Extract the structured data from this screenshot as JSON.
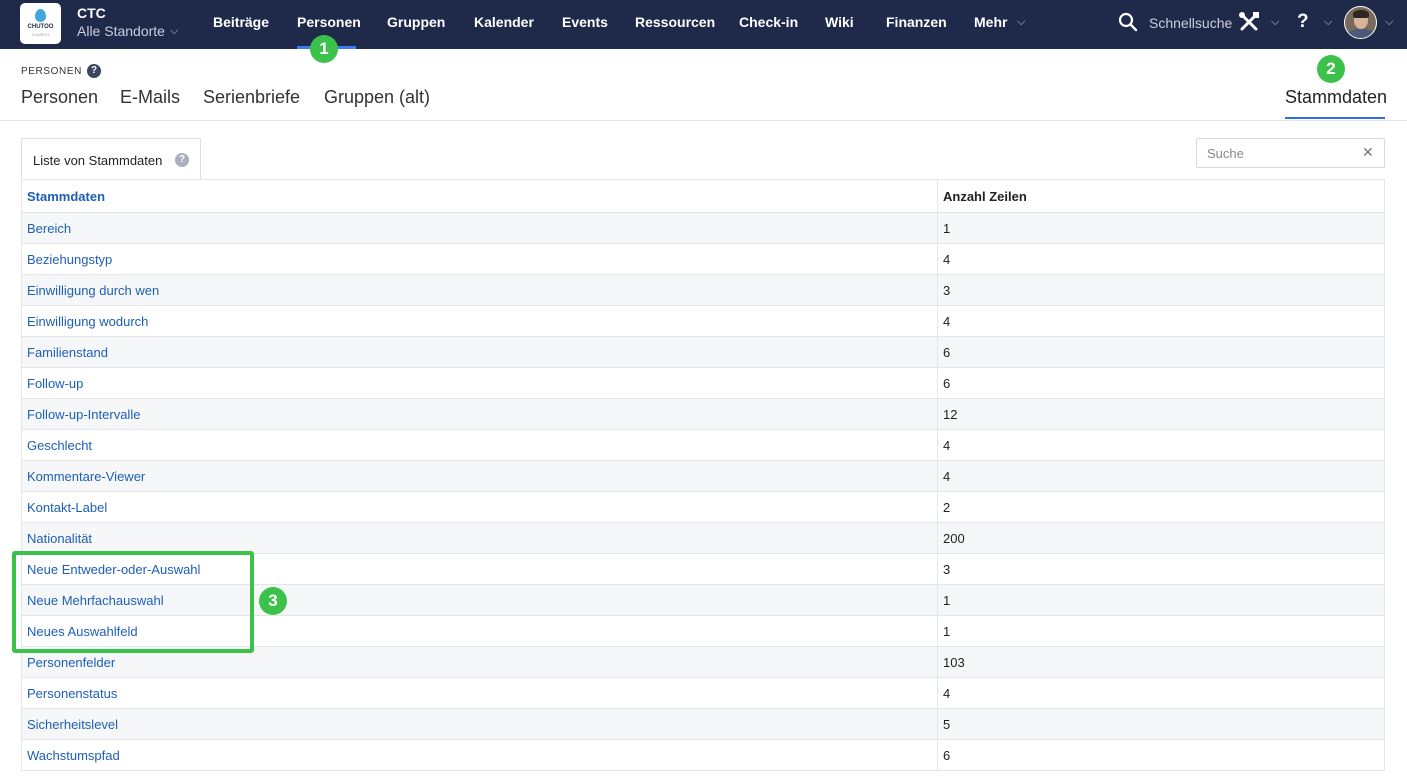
{
  "app": {
    "logo_text": "CHUTOO",
    "logo_sub": "CHURCH",
    "org_name": "CTC",
    "location": "Alle Standorte"
  },
  "nav": {
    "items": [
      "Beiträge",
      "Personen",
      "Gruppen",
      "Kalender",
      "Events",
      "Ressourcen",
      "Check-in",
      "Wiki",
      "Finanzen",
      "Mehr"
    ],
    "active": "Personen"
  },
  "header_right": {
    "search_label": "Schnellsuche",
    "help_label": "?"
  },
  "callouts": [
    "1",
    "2",
    "3"
  ],
  "section": {
    "label": "PERSONEN",
    "help": "?",
    "tabs": [
      "Personen",
      "E-Mails",
      "Serienbriefe",
      "Gruppen (alt)"
    ],
    "right_tab": "Stammdaten"
  },
  "card": {
    "tab_label": "Liste von Stammdaten",
    "tab_help": "?",
    "search_placeholder": "Suche",
    "search_clear": "✕"
  },
  "table": {
    "columns": [
      "Stammdaten",
      "Anzahl Zeilen"
    ],
    "rows": [
      {
        "name": "Bereich",
        "count": "1"
      },
      {
        "name": "Beziehungstyp",
        "count": "4"
      },
      {
        "name": "Einwilligung durch wen",
        "count": "3"
      },
      {
        "name": "Einwilligung wodurch",
        "count": "4"
      },
      {
        "name": "Familienstand",
        "count": "6"
      },
      {
        "name": "Follow-up",
        "count": "6"
      },
      {
        "name": "Follow-up-Intervalle",
        "count": "12"
      },
      {
        "name": "Geschlecht",
        "count": "4"
      },
      {
        "name": "Kommentare-Viewer",
        "count": "4"
      },
      {
        "name": "Kontakt-Label",
        "count": "2"
      },
      {
        "name": "Nationalität",
        "count": "200"
      },
      {
        "name": "Neue Entweder-oder-Auswahl",
        "count": "3"
      },
      {
        "name": "Neue Mehrfachauswahl",
        "count": "1"
      },
      {
        "name": "Neues Auswahlfeld",
        "count": "1"
      },
      {
        "name": "Personenfelder",
        "count": "103"
      },
      {
        "name": "Personenstatus",
        "count": "4"
      },
      {
        "name": "Sicherheitslevel",
        "count": "5"
      },
      {
        "name": "Wachstumspfad",
        "count": "6"
      }
    ]
  },
  "colors": {
    "topbar": "#1f2a4b",
    "link": "#1d5fb6",
    "callout": "#3cc24a",
    "active_underline": "#3d7bf3"
  }
}
